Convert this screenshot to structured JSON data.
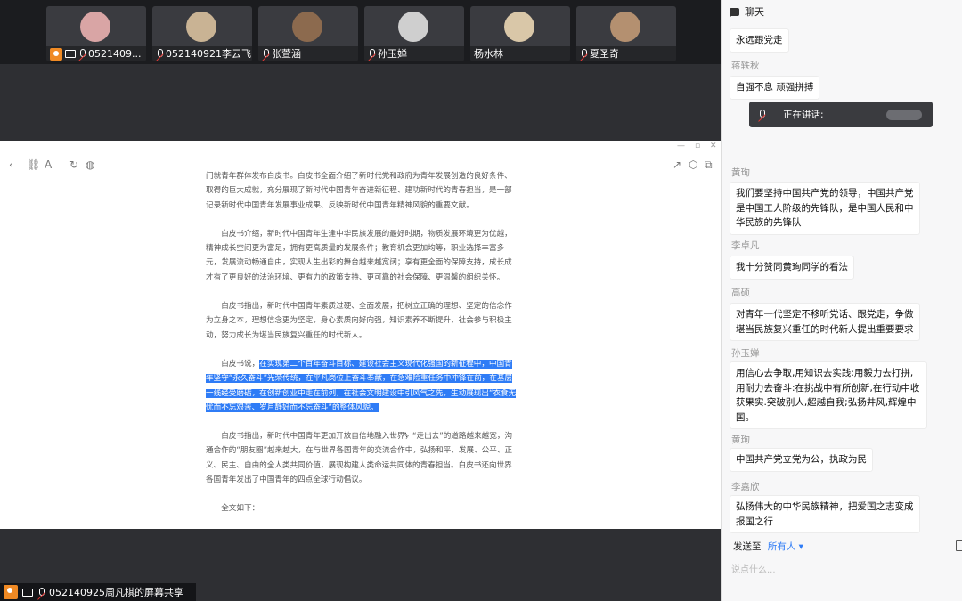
{
  "participants": [
    {
      "name": "0521409...",
      "avatar_color": "#d9a5a5",
      "host": true,
      "sharing": true
    },
    {
      "name": "052140921李云飞",
      "avatar_color": "#c9b394",
      "host": false,
      "sharing": false
    },
    {
      "name": "张萱涵",
      "avatar_color": "#8c6a4e",
      "host": false,
      "sharing": false
    },
    {
      "name": "孙玉婵",
      "avatar_color": "#cfcfcf",
      "host": false,
      "sharing": false
    },
    {
      "name": "杨水林",
      "avatar_color": "#d9c7a8",
      "host": false,
      "sharing": false
    },
    {
      "name": "夏圣奇",
      "avatar_color": "#b49070",
      "host": false,
      "sharing": false
    }
  ],
  "share_bar": {
    "label": "052140925周凡棋的屏幕共享"
  },
  "document": {
    "paragraphs": [
      "门就青年群体发布白皮书。白皮书全面介绍了新时代党和政府为青年发展创造的良好条件、取得的巨大成就，充分展现了新时代中国青年奋进新征程、建功新时代的青春担当，是一部记录新时代中国青年发展事业成果、反映新时代中国青年精神风貌的重要文献。",
      "白皮书介绍，新时代中国青年生逢中华民族发展的最好时期，物质发展环境更为优越，精神成长空间更为富足，拥有更高质量的发展条件；教育机会更加均等，职业选择丰富多元，发展流动畅通自由，实现人生出彩的舞台越来越宽阔；享有更全面的保障支持，成长成才有了更良好的法治环境、更有力的政策支持、更可靠的社会保障、更温馨的组织关怀。",
      "白皮书指出，新时代中国青年素质过硬、全面发展，把树立正确的理想、坚定的信念作为立身之本，理想信念更为坚定，身心素质向好向强，知识素养不断提升，社会参与积极主动，努力成长为堪当民族复兴重任的时代新人。",
      "白皮书指出，新时代中国青年更加开放自信地融入世界，“走出去”的道路越来越宽，沟通合作的“朋友圈”越来越大，在与世界各国青年的交流合作中，弘扬和平、发展、公平、正义、民主、自由的全人类共同价值，展现构建人类命运共同体的青春担当。白皮书还向世界各国青年发出了中国青年的四点全球行动倡议。",
      "全文如下："
    ],
    "para4_prefix": "白皮书说，",
    "para4_highlight": "在实现第二个百年奋斗目标、建设社会主义现代化强国的新征程中，中国青年坚守“永久奋斗”光荣传统，在平凡岗位上奋斗奉献，在急难险重任务中冲锋在前，在基层一线经受磨砺，在创新创业中走在前列，在社会文明建设中引风气之先，生动展现出“衣食无忧而不忘艰苦、岁月静好而不忘奋斗”的整体风貌。"
  },
  "chat": {
    "title": "聊天",
    "speaking_label": "正在讲话:",
    "messages": [
      {
        "sender": "",
        "text": "永远跟党走"
      },
      {
        "sender": "蒋轶秋",
        "text": "自强不息 顽强拼搏"
      },
      {
        "sender": "黄珣",
        "text": "我们要坚持中国共产党的领导，中国共产党是中国工人阶级的先锋队，是中国人民和中华民族的先锋队"
      },
      {
        "sender": "李卓凡",
        "text": "我十分赞同黄珣同学的看法"
      },
      {
        "sender": "高硕",
        "text": "对青年一代坚定不移听党话、跟党走，争做堪当民族复兴重任的时代新人提出重要要求"
      },
      {
        "sender": "孙玉婵",
        "text": "用信心去争取,用知识去实践:用毅力去打拼,用耐力去奋斗:在挑战中有所创新,在行动中收获果实.突破别人,超越自我;弘扬井风,辉煌中国。"
      },
      {
        "sender": "黄珣",
        "text": "中国共产党立党为公，执政为民"
      },
      {
        "sender": "李嘉欣",
        "text": "弘扬伟大的中华民族精神，把爱国之志变成报国之行"
      }
    ],
    "send_to_label": "发送至",
    "send_to_value": "所有人",
    "input_placeholder": "说点什么..."
  }
}
